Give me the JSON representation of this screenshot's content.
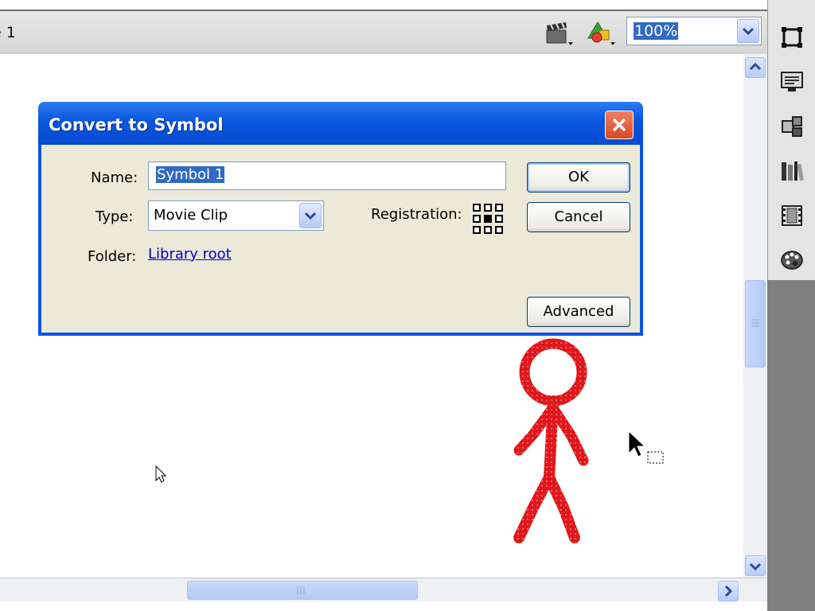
{
  "scene_bar": {
    "scene_label": "e 1",
    "edit_scene_icon": "clapperboard-icon",
    "edit_symbol_icon": "shapes-icon",
    "zoom": {
      "value": "100%"
    }
  },
  "right_panel": {
    "icons": [
      "free-transform-icon",
      "display-monitor-icon",
      "components-icon",
      "library-icon",
      "movie-clip-icon",
      "color-palette-icon"
    ]
  },
  "dialog": {
    "title": "Convert to Symbol",
    "name_label": "Name:",
    "name_value": "Symbol 1",
    "type_label": "Type:",
    "type_value": "Movie Clip",
    "registration_label": "Registration:",
    "folder_label": "Folder:",
    "folder_link": "Library root",
    "ok_label": "OK",
    "cancel_label": "Cancel",
    "advanced_label": "Advanced"
  },
  "colors": {
    "titlebar_blue": "#0a55dd",
    "dialog_face": "#ece9d8",
    "stick_figure_red": "#e0181b",
    "selection_blue": "#316ac5"
  }
}
